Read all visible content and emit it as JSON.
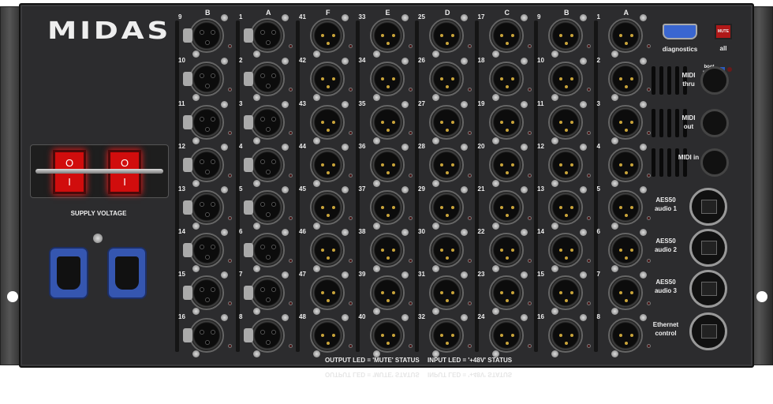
{
  "brand": "MIDAS",
  "supply_voltage_label": "SUPPLY VOLTAGE",
  "switches": [
    {
      "off": "O",
      "on": "I"
    },
    {
      "off": "O",
      "on": "I"
    }
  ],
  "female_columns": [
    {
      "header": "B",
      "numbers": [
        "9",
        "10",
        "11",
        "12",
        "13",
        "14",
        "15",
        "16"
      ]
    },
    {
      "header": "A",
      "numbers": [
        "1",
        "2",
        "3",
        "4",
        "5",
        "6",
        "7",
        "8"
      ]
    }
  ],
  "male_columns": [
    {
      "header": "F",
      "numbers": [
        "41",
        "42",
        "43",
        "44",
        "45",
        "46",
        "47",
        "48"
      ]
    },
    {
      "header": "E",
      "numbers": [
        "33",
        "34",
        "35",
        "36",
        "37",
        "38",
        "39",
        "40"
      ]
    },
    {
      "header": "D",
      "numbers": [
        "25",
        "26",
        "27",
        "28",
        "29",
        "30",
        "31",
        "32"
      ]
    },
    {
      "header": "C",
      "numbers": [
        "17",
        "18",
        "19",
        "20",
        "21",
        "22",
        "23",
        "24"
      ]
    },
    {
      "header": "B",
      "numbers": [
        "9",
        "10",
        "11",
        "12",
        "13",
        "14",
        "15",
        "16"
      ]
    },
    {
      "header": "A",
      "numbers": [
        "1",
        "2",
        "3",
        "4",
        "5",
        "6",
        "7",
        "8"
      ]
    }
  ],
  "diagnostics_label": "diagnostics",
  "mute_button": "MUTE",
  "mute_all_label": "all",
  "boot_mode_label": "boot mode",
  "midi": [
    "MIDI thru",
    "MIDI out",
    "MIDI in"
  ],
  "network_ports": [
    "AES50 audio 1",
    "AES50 audio 2",
    "AES50 audio 3",
    "Ethernet control"
  ],
  "output_led_status": "OUTPUT LED = 'MUTE' STATUS",
  "input_led_status": "INPUT LED = '+48V' STATUS",
  "colors": {
    "chassis": "#2c2c2e",
    "switch_red": "#d10d0d",
    "iec_blue": "#3556b0",
    "mute_red": "#b01818",
    "db9_blue": "#3a66d0"
  }
}
